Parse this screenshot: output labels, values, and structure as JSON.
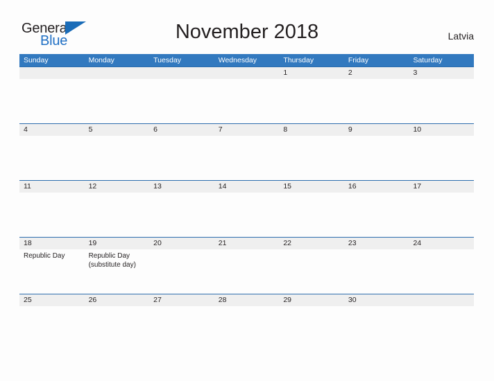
{
  "brand": {
    "name_part1": "General",
    "name_part2": "Blue",
    "flag_icon": "triangle-flag-icon"
  },
  "header": {
    "title": "November 2018",
    "country": "Latvia"
  },
  "calendar": {
    "weekdays": [
      "Sunday",
      "Monday",
      "Tuesday",
      "Wednesday",
      "Thursday",
      "Friday",
      "Saturday"
    ],
    "colors": {
      "header_blue": "#3279bf",
      "row_divider_blue": "#2b6cad",
      "band_gray": "#efefef",
      "brand_blue": "#1f6fc4",
      "text": "#231f20",
      "page_background": "#fdfdfd"
    },
    "weeks": [
      [
        {
          "date": "",
          "events": []
        },
        {
          "date": "",
          "events": []
        },
        {
          "date": "",
          "events": []
        },
        {
          "date": "",
          "events": []
        },
        {
          "date": "1",
          "events": []
        },
        {
          "date": "2",
          "events": []
        },
        {
          "date": "3",
          "events": []
        }
      ],
      [
        {
          "date": "4",
          "events": []
        },
        {
          "date": "5",
          "events": []
        },
        {
          "date": "6",
          "events": []
        },
        {
          "date": "7",
          "events": []
        },
        {
          "date": "8",
          "events": []
        },
        {
          "date": "9",
          "events": []
        },
        {
          "date": "10",
          "events": []
        }
      ],
      [
        {
          "date": "11",
          "events": []
        },
        {
          "date": "12",
          "events": []
        },
        {
          "date": "13",
          "events": []
        },
        {
          "date": "14",
          "events": []
        },
        {
          "date": "15",
          "events": []
        },
        {
          "date": "16",
          "events": []
        },
        {
          "date": "17",
          "events": []
        }
      ],
      [
        {
          "date": "18",
          "events": [
            "Republic Day"
          ]
        },
        {
          "date": "19",
          "events": [
            "Republic Day\n(substitute day)"
          ]
        },
        {
          "date": "20",
          "events": []
        },
        {
          "date": "21",
          "events": []
        },
        {
          "date": "22",
          "events": []
        },
        {
          "date": "23",
          "events": []
        },
        {
          "date": "24",
          "events": []
        }
      ],
      [
        {
          "date": "25",
          "events": []
        },
        {
          "date": "26",
          "events": []
        },
        {
          "date": "27",
          "events": []
        },
        {
          "date": "28",
          "events": []
        },
        {
          "date": "29",
          "events": []
        },
        {
          "date": "30",
          "events": []
        },
        {
          "date": "",
          "events": []
        }
      ]
    ]
  }
}
